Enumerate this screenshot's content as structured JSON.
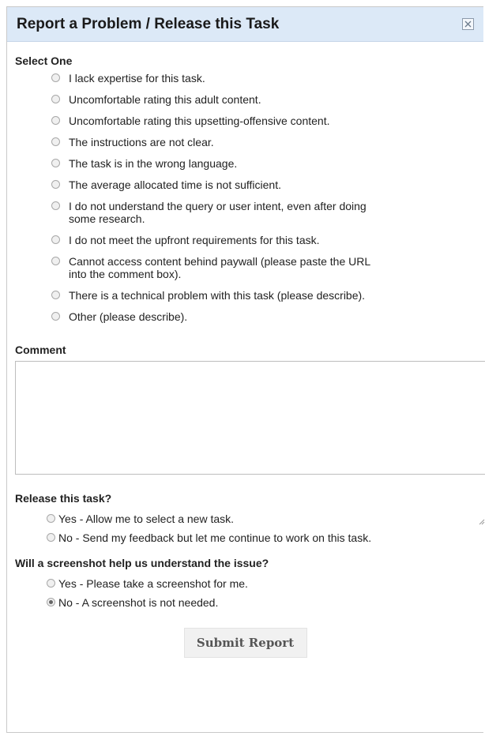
{
  "dialog": {
    "title": "Report a Problem / Release this Task",
    "close_icon": "close-icon"
  },
  "problem": {
    "label": "Select One",
    "options": [
      {
        "lines": [
          "I lack expertise for this task."
        ],
        "checked": false
      },
      {
        "lines": [
          "Uncomfortable rating this adult content."
        ],
        "checked": false
      },
      {
        "lines": [
          "Uncomfortable rating this upsetting-offensive content."
        ],
        "checked": false
      },
      {
        "lines": [
          "The instructions are not clear."
        ],
        "checked": false
      },
      {
        "lines": [
          "The task is in the wrong language."
        ],
        "checked": false
      },
      {
        "lines": [
          "The average allocated time is not sufficient."
        ],
        "checked": false
      },
      {
        "lines": [
          "I do not understand the query or user intent, even after doing",
          "some research."
        ],
        "checked": false
      },
      {
        "lines": [
          "I do not meet the upfront requirements for this task."
        ],
        "checked": false
      },
      {
        "lines": [
          "Cannot access content behind paywall (please paste the URL",
          "into the comment box)."
        ],
        "checked": false
      },
      {
        "lines": [
          "There is a technical problem with this task (please describe)."
        ],
        "checked": false
      },
      {
        "lines": [
          "Other (please describe)."
        ],
        "checked": false
      }
    ]
  },
  "comment": {
    "label": "Comment",
    "value": ""
  },
  "release": {
    "label": "Release this task?",
    "options": [
      {
        "lines": [
          "Yes - Allow me to select a new task."
        ],
        "checked": false
      },
      {
        "lines": [
          "No - Send my feedback but let me continue to work on this task."
        ],
        "checked": false
      }
    ]
  },
  "screenshot": {
    "label": "Will a screenshot help us understand the issue?",
    "options": [
      {
        "lines": [
          "Yes - Please take a screenshot for me."
        ],
        "checked": false
      },
      {
        "lines": [
          "No - A screenshot is not needed."
        ],
        "checked": true
      }
    ]
  },
  "submit": {
    "label": "Submit Report"
  }
}
